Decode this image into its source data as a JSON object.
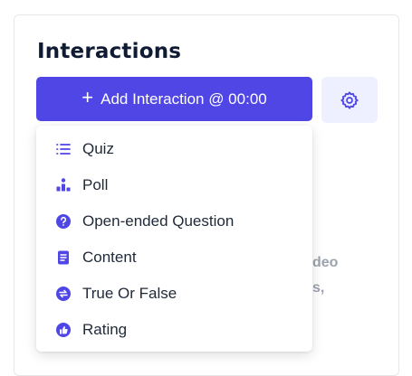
{
  "header": {
    "title": "Interactions"
  },
  "toolbar": {
    "add_label": "Add Interaction @ 00:00"
  },
  "background": {
    "line1": "deo",
    "line2": "s,"
  },
  "menu": {
    "items": [
      {
        "label": "Quiz",
        "icon": "list-icon"
      },
      {
        "label": "Poll",
        "icon": "bar-chart-icon"
      },
      {
        "label": "Open-ended Question",
        "icon": "question-circle-icon"
      },
      {
        "label": "Content",
        "icon": "document-icon"
      },
      {
        "label": "True Or False",
        "icon": "swap-circle-icon"
      },
      {
        "label": "Rating",
        "icon": "thumbs-up-circle-icon"
      }
    ]
  },
  "colors": {
    "accent": "#4f46e5",
    "accent_light": "#eef0ff"
  }
}
